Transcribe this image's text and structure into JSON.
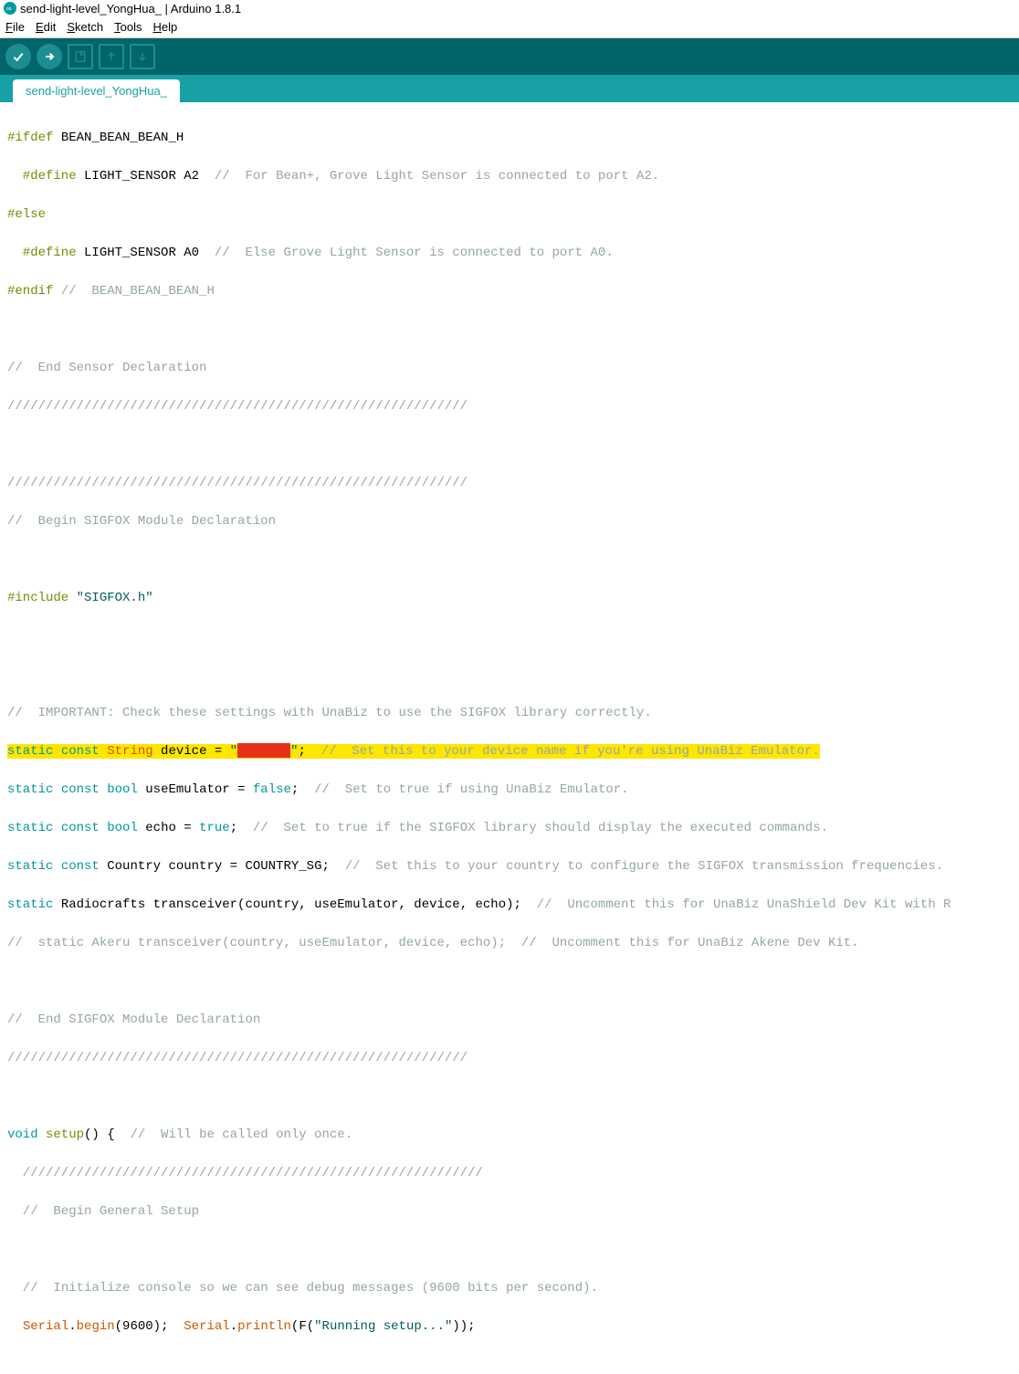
{
  "window": {
    "title": "send-light-level_YongHua_ | Arduino 1.8.1"
  },
  "menu": {
    "file": "File",
    "edit": "Edit",
    "sketch": "Sketch",
    "tools": "Tools",
    "help": "Help"
  },
  "tab": {
    "name": "send-light-level_YongHua_"
  },
  "code": {
    "l01a": "#ifdef",
    "l01b": " BEAN_BEAN_BEAN_H",
    "l02a": "  #define",
    "l02b": " LIGHT_SENSOR A2  ",
    "l02c": "//  For Bean+, Grove Light Sensor is connected to port A2.",
    "l03a": "#else",
    "l04a": "  #define",
    "l04b": " LIGHT_SENSOR A0  ",
    "l04c": "//  Else Grove Light Sensor is connected to port A0.",
    "l05a": "#endif",
    "l05b": " //  BEAN_BEAN_BEAN_H",
    "l07": "//  End Sensor Declaration",
    "l08": "////////////////////////////////////////////////////////////",
    "l10": "////////////////////////////////////////////////////////////",
    "l11": "//  Begin SIGFOX Module Declaration",
    "l13a": "#include",
    "l13b": " \"SIGFOX.h\"",
    "l15": "//  IMPORTANT: Check these settings with UnaBiz to use the SIGFOX library correctly.",
    "l16a": "static",
    "l16b": " const",
    "l16c": " String",
    "l16d": " device = ",
    "l16e": "\"",
    "l16f": "\"",
    "l16g": ";  ",
    "l16h": "//  Set this to your device name if you're using UnaBiz Emulator.",
    "l17a": "static",
    "l17b": " const",
    "l17c": " bool",
    "l17d": " useEmulator = ",
    "l17e": "false",
    "l17f": ";  ",
    "l17g": "//  Set to true if using UnaBiz Emulator.",
    "l18a": "static",
    "l18b": " const",
    "l18c": " bool",
    "l18d": " echo = ",
    "l18e": "true",
    "l18f": ";  ",
    "l18g": "//  Set to true if the SIGFOX library should display the executed commands.",
    "l19a": "static",
    "l19b": " const",
    "l19c": " Country country = COUNTRY_SG;  ",
    "l19d": "//  Set this to your country to configure the SIGFOX transmission frequencies.",
    "l20a": "static",
    "l20b": " Radiocrafts transceiver(country, useEmulator, device, echo);  ",
    "l20c": "//  Uncomment this for UnaBiz UnaShield Dev Kit with R",
    "l21": "//  static Akeru transceiver(country, useEmulator, device, echo);  //  Uncomment this for UnaBiz Akene Dev Kit.",
    "l23": "//  End SIGFOX Module Declaration",
    "l24": "////////////////////////////////////////////////////////////",
    "l26a": "void",
    "l26b": " setup",
    "l26c": "() {  ",
    "l26d": "//  Will be called only once.",
    "l27": "  ////////////////////////////////////////////////////////////",
    "l28": "  //  Begin General Setup",
    "l30": "  //  Initialize console so we can see debug messages (9600 bits per second).",
    "l31a": "  ",
    "l31b": "Serial",
    "l31c": ".",
    "l31d": "begin",
    "l31e": "(9600);  ",
    "l31f": "Serial",
    "l31g": ".",
    "l31h": "println",
    "l31i": "(F(",
    "l31j": "\"Running setup...\"",
    "l31k": "));"
  }
}
